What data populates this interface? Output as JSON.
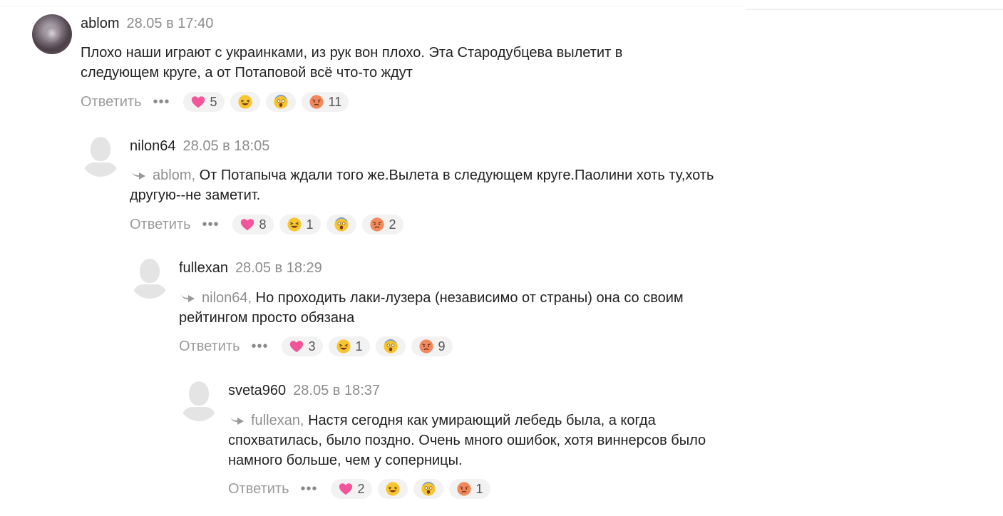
{
  "reply_label": "Ответить",
  "more_label": "•••",
  "colors": {
    "heart": "#f2559a",
    "face": "#f7c531",
    "angry": "#f08a5c",
    "muted_text": "#8d8d8d",
    "pill_bg": "#f2f2f2"
  },
  "comments": [
    {
      "author": "ablom",
      "date": "28.05 в 17:40",
      "avatar": "photo-avatar",
      "reply_to": "",
      "text": "Плохо наши играют с украинками, из рук вон плохо. Эта Стародубцева вылетит в следующем круге, а от Потаповой всё что-то ждут",
      "reactions": {
        "heart": "5",
        "laugh": "",
        "shock": "",
        "angry": "11"
      }
    },
    {
      "author": "nilon64",
      "date": "28.05 в 18:05",
      "avatar": "default-avatar",
      "reply_to": "ablom,",
      "text": "От Потапыча ждали того же.Вылета в следующем круге.Паолини хоть ту,хоть другую--не заметит.",
      "reactions": {
        "heart": "8",
        "laugh": "1",
        "shock": "",
        "angry": "2"
      }
    },
    {
      "author": "fullexan",
      "date": "28.05 в 18:29",
      "avatar": "default-avatar",
      "reply_to": "nilon64,",
      "text": "Но проходить лаки-лузера (независимо от страны) она со своим рейтингом просто обязана",
      "reactions": {
        "heart": "3",
        "laugh": "1",
        "shock": "",
        "angry": "9"
      }
    },
    {
      "author": "sveta960",
      "date": "28.05 в 18:37",
      "avatar": "default-avatar",
      "reply_to": "fullexan,",
      "text": "Настя сегодня как умирающий лебедь была, а когда спохватилась, было поздно.  Очень много ошибок, хотя виннерсов было намного больше, чем у соперницы.",
      "reactions": {
        "heart": "2",
        "laugh": "",
        "shock": "",
        "angry": "1"
      }
    }
  ]
}
